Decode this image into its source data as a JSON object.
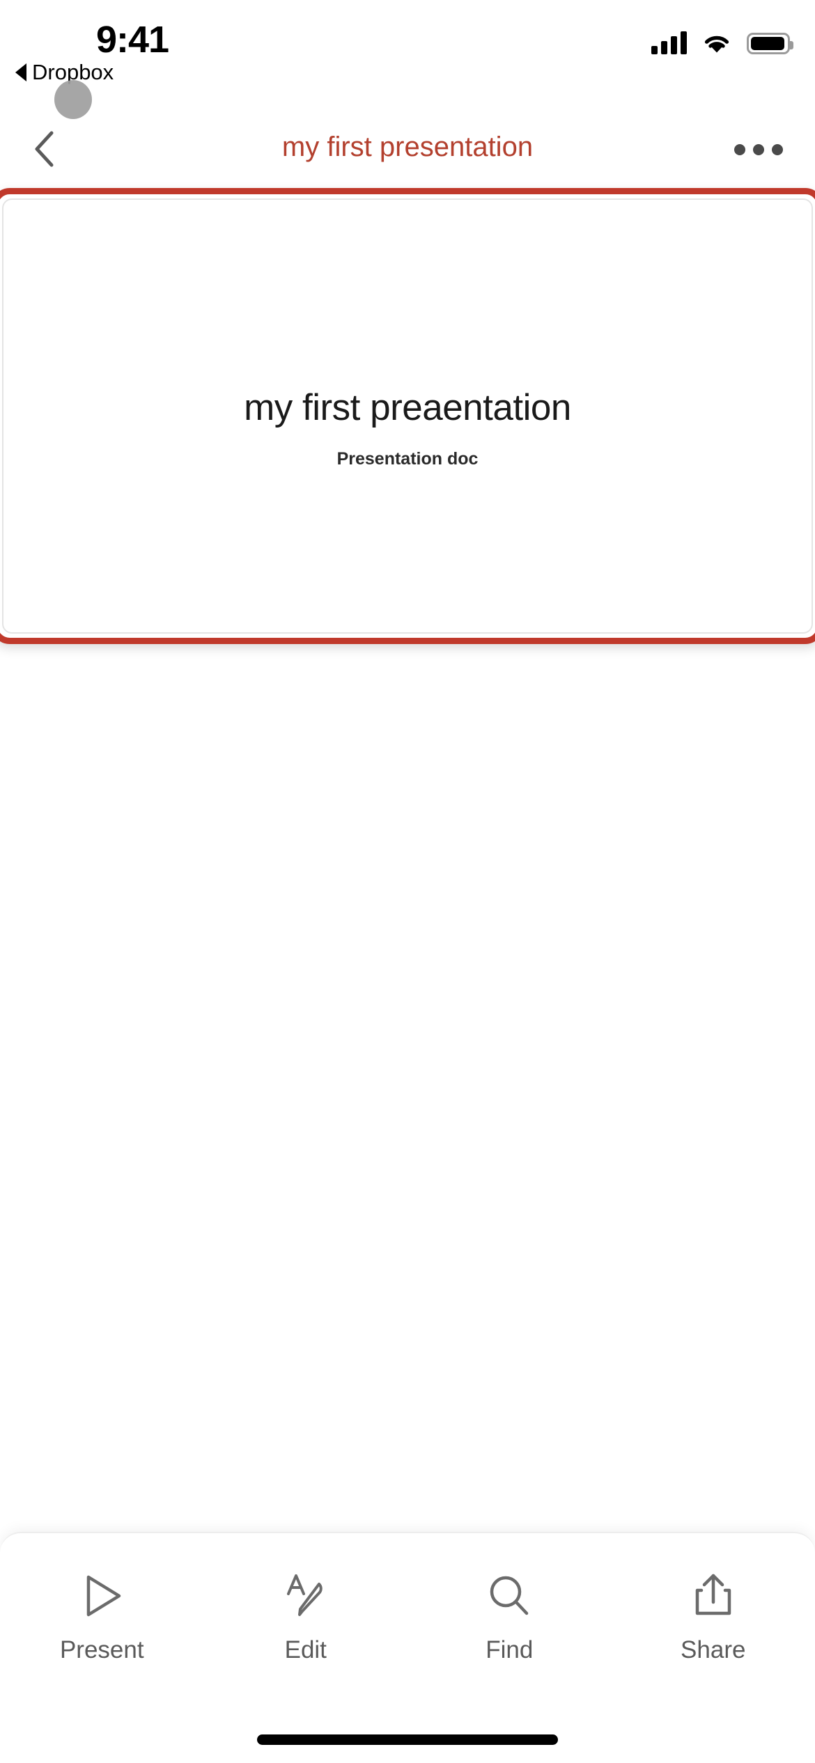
{
  "status_bar": {
    "time": "9:41",
    "back_app_label": "Dropbox",
    "signal_icon": "cellular-signal-icon",
    "signal_bars_filled": 4,
    "wifi_icon": "wifi-icon",
    "battery_icon": "battery-full-icon"
  },
  "nav_bar": {
    "back_icon": "chevron-left-icon",
    "title": "my first presentation",
    "title_color": "#B3402E",
    "more_icon": "ellipsis-icon"
  },
  "slide": {
    "title": "my first preaentation",
    "subtitle": "Presentation doc",
    "selection_border_color": "#C0392B",
    "background_color": "#FFFFFF"
  },
  "toolbar": {
    "items": [
      {
        "label": "Present",
        "icon": "play-triangle-icon"
      },
      {
        "label": "Edit",
        "icon": "markup-pencil-icon"
      },
      {
        "label": "Find",
        "icon": "search-icon"
      },
      {
        "label": "Share",
        "icon": "share-upload-icon"
      }
    ]
  }
}
